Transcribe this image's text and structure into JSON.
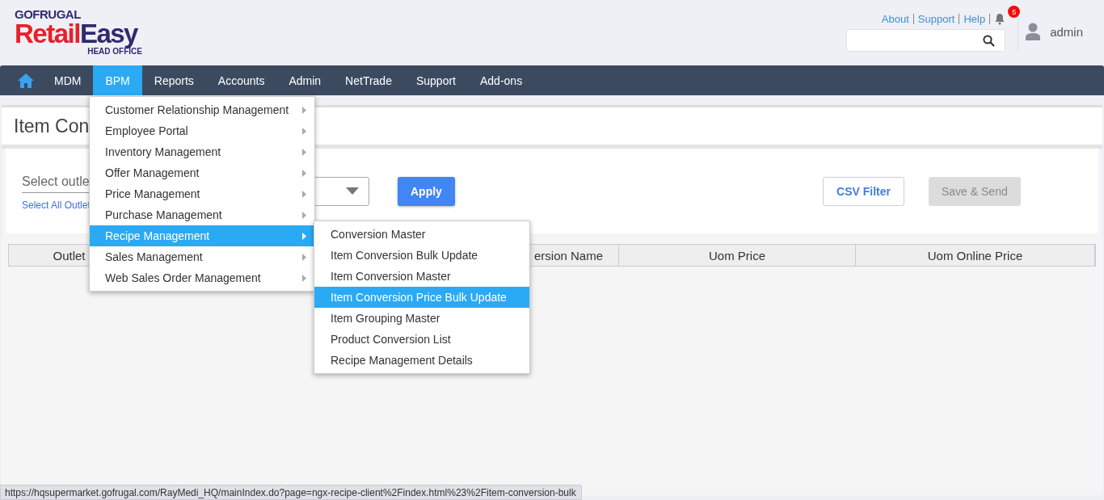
{
  "header": {
    "logo": {
      "brand": "GOFRUGAL",
      "wordmark": [
        {
          "text": "Retail",
          "color": "#e8202a"
        },
        {
          "text": "Easy",
          "color": "#2e2a72"
        }
      ],
      "edition": "HEAD OFFICE"
    },
    "links": [
      "About",
      "Support",
      "Help"
    ],
    "notifications": {
      "count": "5"
    },
    "user": "admin"
  },
  "nav": [
    {
      "label": "MDM",
      "selected": false
    },
    {
      "label": "BPM",
      "selected": true
    },
    {
      "label": "Reports",
      "selected": false
    },
    {
      "label": "Accounts",
      "selected": false
    },
    {
      "label": "Admin",
      "selected": false
    },
    {
      "label": "NetTrade",
      "selected": false
    },
    {
      "label": "Support",
      "selected": false
    },
    {
      "label": "Add-ons",
      "selected": false
    }
  ],
  "menu": [
    {
      "label": "Customer Relationship Management",
      "selected": false
    },
    {
      "label": "Employee Portal",
      "selected": false
    },
    {
      "label": "Inventory Management",
      "selected": false
    },
    {
      "label": "Offer Management",
      "selected": false
    },
    {
      "label": "Price Management",
      "selected": false
    },
    {
      "label": "Purchase Management",
      "selected": false
    },
    {
      "label": "Recipe Management",
      "selected": true
    },
    {
      "label": "Sales Management",
      "selected": false
    },
    {
      "label": "Web Sales Order Management",
      "selected": false
    }
  ],
  "submenu": [
    {
      "label": "Conversion Master",
      "selected": false
    },
    {
      "label": "Item Conversion Bulk Update",
      "selected": false
    },
    {
      "label": "Item Conversion Master",
      "selected": false
    },
    {
      "label": "Item Conversion Price Bulk Update",
      "selected": true
    },
    {
      "label": "Item Grouping Master",
      "selected": false
    },
    {
      "label": "Product Conversion List",
      "selected": false
    },
    {
      "label": "Recipe Management Details",
      "selected": false
    }
  ],
  "page": {
    "title": "Item Con",
    "outlet_field": {
      "placeholder": "Select outle"
    },
    "select_all_link": "Select All Outlet",
    "buttons": [
      {
        "label": "Apply",
        "kind": "primary",
        "disabled": false
      },
      {
        "label": "CSV Filter",
        "kind": "outline",
        "disabled": false
      },
      {
        "label": "Save & Send",
        "kind": "plain",
        "disabled": true
      }
    ],
    "table": {
      "columns": [
        "Outlet",
        "ersion Name",
        "Uom Price",
        "Uom Online Price"
      ]
    }
  },
  "status_bar": {
    "url": "https://hqsupermarket.gofrugal.com/RayMedi_HQ/mainIndex.do?page=ngx-recipe-client%2Findex.html%23%2Fitem-conversion-bulk"
  }
}
